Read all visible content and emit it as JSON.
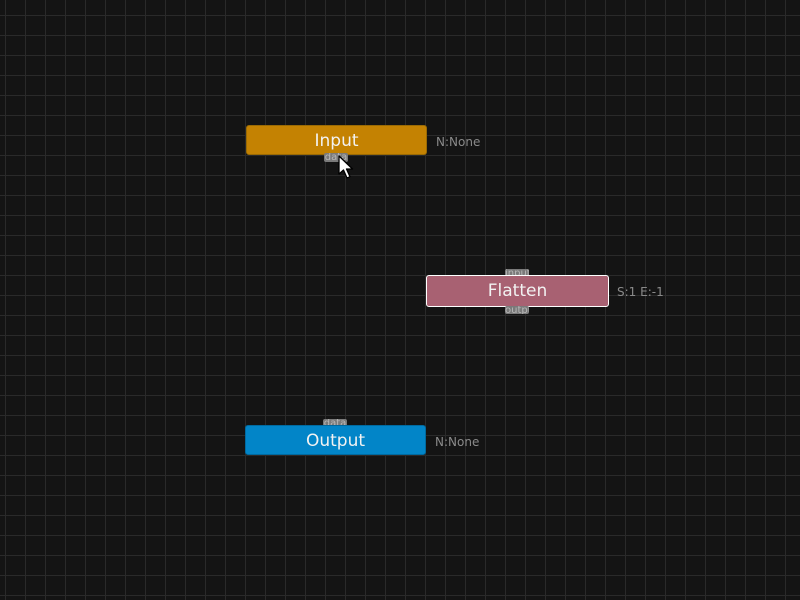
{
  "colors": {
    "background": "#141414",
    "grid": "#2a2a2a",
    "input_node": "#c48202",
    "flatten_node": "#a86172",
    "output_node": "#0285c8",
    "label_text": "#8a8a8a"
  },
  "nodes": [
    {
      "id": "input",
      "title": "Input",
      "info": "N:None",
      "ports": {
        "bottom": "data"
      }
    },
    {
      "id": "flatten",
      "title": "Flatten",
      "info": "S:1 E:-1",
      "ports": {
        "top": "input",
        "bottom": "output"
      }
    },
    {
      "id": "output",
      "title": "Output",
      "info": "N:None",
      "ports": {
        "top": "data"
      }
    }
  ],
  "cursor": {
    "icon": "pointer-arrow-icon"
  }
}
